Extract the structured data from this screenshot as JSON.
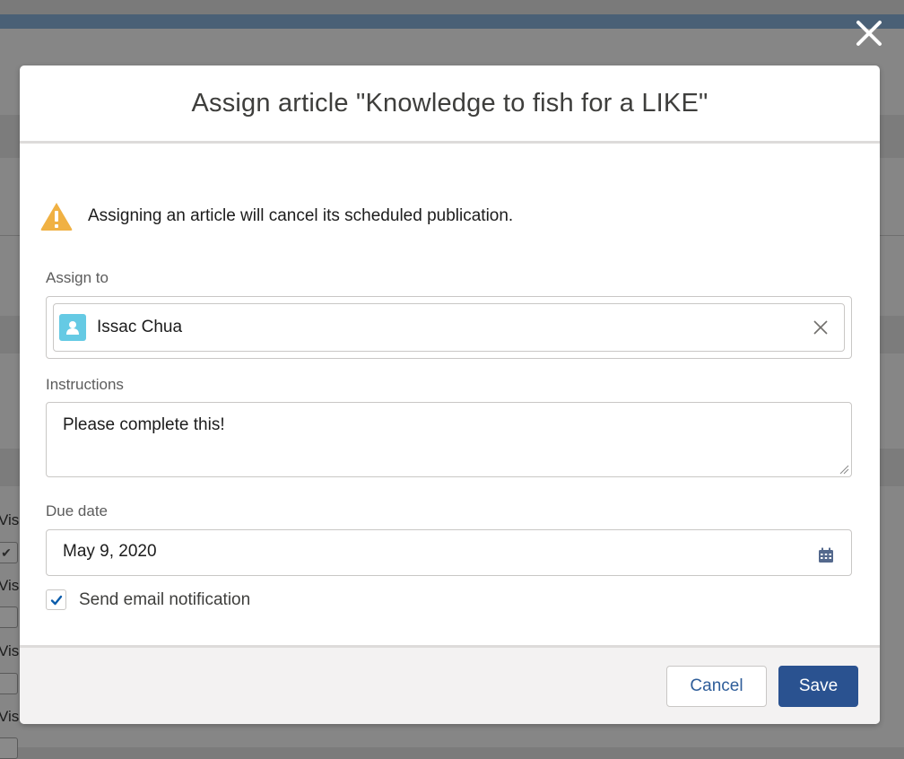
{
  "background_page": {
    "row_labels": [
      "Vis",
      "Vis",
      "Vis",
      "Vis"
    ]
  },
  "modal": {
    "title": "Assign article \"Knowledge to fish for a LIKE\"",
    "close_icon": "close-icon",
    "warning": {
      "icon": "warning-icon",
      "text": "Assigning an article will cancel its scheduled publication.",
      "color": "#f0b143"
    },
    "assign_to": {
      "label": "Assign to",
      "value": "Issac Chua",
      "avatar_icon": "contact-icon",
      "avatar_color": "#65cae4",
      "remove_icon": "remove-icon"
    },
    "instructions": {
      "label": "Instructions",
      "value": "Please complete this!"
    },
    "due_date": {
      "label": "Due date",
      "value": "May 9, 2020",
      "icon": "calendar-icon"
    },
    "email_notification": {
      "label": "Send email notification",
      "checked": true
    },
    "footer": {
      "cancel_label": "Cancel",
      "save_label": "Save",
      "save_color": "#2a5290"
    }
  }
}
